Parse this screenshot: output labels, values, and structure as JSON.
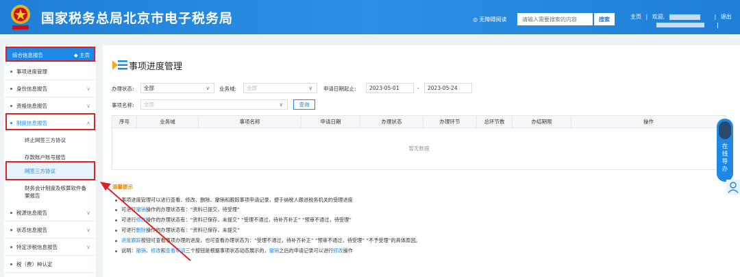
{
  "header": {
    "site_title": "国家税务总局北京市电子税务局",
    "accessibility": "◎ 无障碍阅读",
    "search_placeholder": "请输入需要搜索的内容",
    "search_button": "搜索",
    "home": "主页",
    "welcome": "欢迎,",
    "logout": "退出"
  },
  "sidebar": {
    "top": "综合信息报告",
    "top_home": "◆ 主页",
    "items": [
      "事项进度管理",
      "身份信息报告",
      "资格信息报告",
      "制度信息报告",
      "终止网签三方协议",
      "存款账户账号报告",
      "网签三方协议",
      "财务会计制度及核算软件备",
      "案报告",
      "税源信息报告",
      "状态信息报告",
      "特定涉税信息报告",
      "税（费）种认定"
    ]
  },
  "main": {
    "title": "事项进度管理",
    "filters": {
      "status_label": "办理状态:",
      "status_value": "全部",
      "domain_label": "业务域:",
      "domain_value": "全部",
      "date_label": "申请日期起止:",
      "date_start": "2023-05-01",
      "date_sep": "-",
      "date_end": "2023-05-24",
      "name_label": "事项名称:",
      "name_value": "全部",
      "query": "查询"
    },
    "table": {
      "headers": [
        "序号",
        "业务域",
        "事项名称",
        "申请日期",
        "办理状态",
        "办理环节",
        "总环节数",
        "办结期限",
        "操作"
      ],
      "empty": "暂无数据"
    },
    "tips": {
      "title": "温馨提示",
      "line1": "事项进度管理可以进行查看、修改、删除、撤销和跟踪事项申请记录，便于纳税人跟进税务机关的受理进度",
      "line2a": "可进行",
      "line2b": "撤销",
      "line2c": "操作的办理状态有：“资料已提交，待受理”",
      "line3a": "可进行",
      "line3b": "修改",
      "line3c": "操作的办理状态有：“资料已保存，未提交”  “受理不通过，待补齐补正”  “预审不通过，待受理”",
      "line4a": "可进行",
      "line4b": "删除",
      "line4c": "操作的办理状态有：“资料已保存，未提交”",
      "line5a": "进度跟踪",
      "line5b": "按钮可查看事项办理的进度，也可查看办理状态为：“受理不通过，待补齐补正”  “预审不通过，待受理”  “不予受理”的具体原因。",
      "line6a": "说明：",
      "line6b": "撤销",
      "line6c": "、",
      "line6d": "修改",
      "line6e": "和",
      "line6f": "查看申请",
      "line6g": "三个按钮是根据事项状态动态展示的，",
      "line6h": "撤销",
      "line6i": "之后的申请记录可以进行",
      "line6j": "修改",
      "line6k": "操作"
    }
  },
  "float": {
    "online": [
      "在",
      "线",
      "导",
      "办"
    ]
  }
}
